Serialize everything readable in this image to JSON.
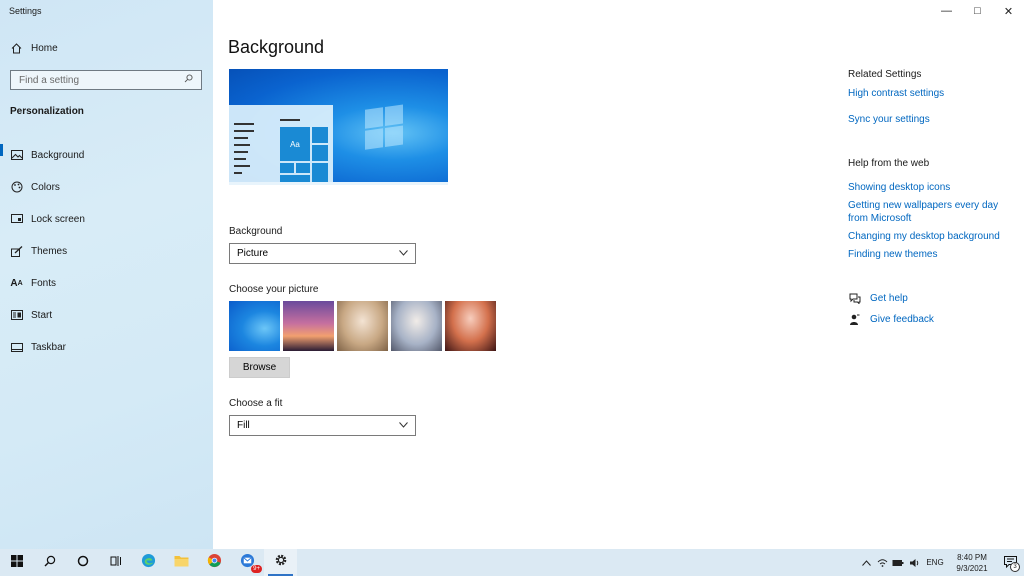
{
  "window": {
    "title": "Settings",
    "minimize": "—",
    "maximize": "□",
    "close": "✕"
  },
  "sidebar": {
    "home_label": "Home",
    "search_placeholder": "Find a setting",
    "section": "Personalization",
    "items": [
      {
        "label": "Background",
        "icon": "image-icon",
        "active": true
      },
      {
        "label": "Colors",
        "icon": "palette-icon",
        "active": false
      },
      {
        "label": "Lock screen",
        "icon": "lock-screen-icon",
        "active": false
      },
      {
        "label": "Themes",
        "icon": "themes-brush-icon",
        "active": false
      },
      {
        "label": "Fonts",
        "icon": "fonts-icon",
        "active": false
      },
      {
        "label": "Start",
        "icon": "start-icon",
        "active": false
      },
      {
        "label": "Taskbar",
        "icon": "taskbar-icon",
        "active": false
      }
    ]
  },
  "main": {
    "title": "Background",
    "preview": {
      "tile_text": "Aa"
    },
    "background_label": "Background",
    "background_value": "Picture",
    "choose_picture_label": "Choose your picture",
    "browse_label": "Browse",
    "fit_label": "Choose a fit",
    "fit_value": "Fill"
  },
  "right": {
    "related_heading": "Related Settings",
    "related_links": [
      "High contrast settings",
      "Sync your settings"
    ],
    "web_heading": "Help from the web",
    "web_links": [
      "Showing desktop icons",
      "Getting new wallpapers every day from Microsoft",
      "Changing my desktop background",
      "Finding new themes"
    ],
    "get_help": "Get help",
    "give_feedback": "Give feedback"
  },
  "taskbar": {
    "language": "ENG",
    "time": "8:40 PM",
    "date": "9/3/2021",
    "notification_count": "3",
    "mail_badge": "9+"
  },
  "colors": {
    "accent": "#0067c0",
    "sidebar_bg": "#d4eaf6",
    "taskbar_bg": "#dbe9f3"
  }
}
